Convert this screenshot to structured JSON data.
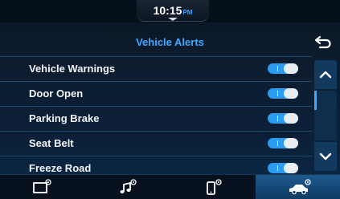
{
  "clock": {
    "time": "10:15",
    "ampm": "PM"
  },
  "header": {
    "title": "Vehicle Alerts"
  },
  "alerts": [
    {
      "label": "Vehicle Warnings",
      "enabled": true
    },
    {
      "label": "Door Open",
      "enabled": true
    },
    {
      "label": "Parking Brake",
      "enabled": true
    },
    {
      "label": "Seat Belt",
      "enabled": true
    },
    {
      "label": "Freeze Road",
      "enabled": true
    }
  ],
  "icons": {
    "back": "back-arrow-icon",
    "scroll_up": "chevron-up-icon",
    "scroll_down": "chevron-down-icon",
    "nav": [
      "display-settings-icon",
      "audio-settings-icon",
      "phone-settings-icon",
      "vehicle-settings-icon"
    ]
  },
  "nav": {
    "active_index": 3
  },
  "colors": {
    "accent": "#3fa9ff",
    "toggle_on": "#2a9cf2",
    "background": "#0b2038"
  }
}
